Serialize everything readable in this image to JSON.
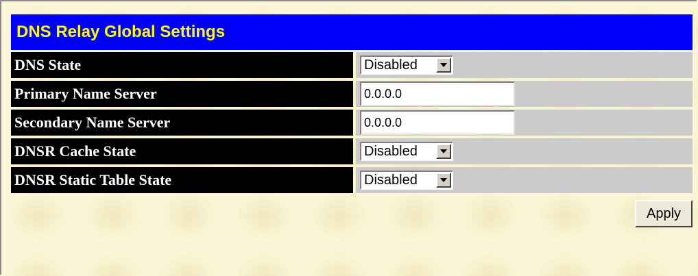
{
  "title": "DNS Relay Global Settings",
  "colors": {
    "title_bg": "#0000ff",
    "title_text": "#ffff00",
    "label_bg": "#000000",
    "label_text": "#ffffff",
    "value_bg": "#cbcbcb",
    "page_bg": "#fbf6d6"
  },
  "fields": {
    "dns_state": {
      "label": "DNS State",
      "value": "Disabled"
    },
    "primary_name_server": {
      "label": "Primary Name Server",
      "value": "0.0.0.0"
    },
    "secondary_name_server": {
      "label": "Secondary Name Server",
      "value": "0.0.0.0"
    },
    "dnsr_cache_state": {
      "label": "DNSR Cache State",
      "value": "Disabled"
    },
    "dnsr_static_table_state": {
      "label": "DNSR Static Table State",
      "value": "Disabled"
    }
  },
  "icons": {
    "dropdown": "chevron-down-icon"
  },
  "apply_label": "Apply"
}
